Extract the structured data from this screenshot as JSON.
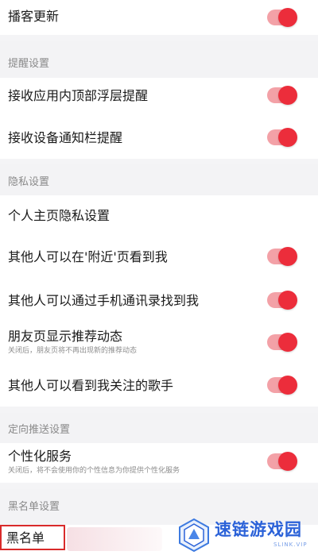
{
  "rows": {
    "podcast_update": "播客更新",
    "in_app_float": "接收应用内顶部浮层提醒",
    "notification_bar": "接收设备通知栏提醒",
    "profile_privacy": "个人主页隐私设置",
    "nearby_visible": "其他人可以在'附近'页看到我",
    "contacts_find": "其他人可以通过手机通讯录找到我",
    "friends_recommend": "朋友页显示推荐动态",
    "friends_recommend_sub": "关闭后，朋友页将不再出现新的推荐动态",
    "followed_singers": "其他人可以看到我关注的歌手",
    "personalized": "个性化服务",
    "personalized_sub": "关闭后，将不会使用你的个性信息为你提供个性化服务",
    "blacklist": "黑名单"
  },
  "sections": {
    "reminder": "提醒设置",
    "privacy": "隐私设置",
    "targeted_push": "定向推送设置",
    "blacklist": "黑名单设置"
  },
  "toggles": {
    "podcast_update": true,
    "in_app_float": true,
    "notification_bar": true,
    "nearby_visible": true,
    "contacts_find": true,
    "friends_recommend": true,
    "followed_singers": true,
    "personalized": true
  },
  "colors": {
    "toggle_on_knob": "#ec2d3b",
    "toggle_on_track": "#f3a1a7",
    "highlight_box": "#d92a2a"
  },
  "watermark": {
    "text": "速链游戏园",
    "sub": "SLINK.VIP"
  }
}
